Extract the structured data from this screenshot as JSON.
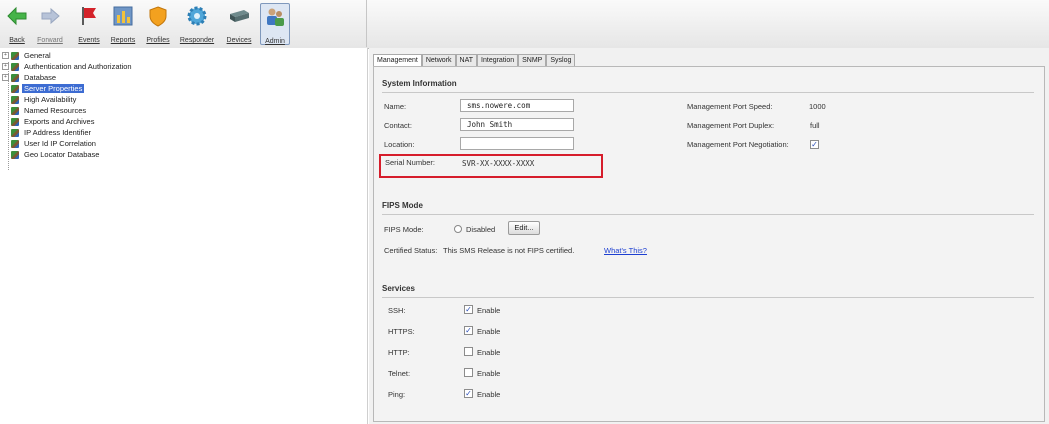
{
  "toolbar": {
    "buttons": [
      {
        "label": "Back",
        "icon": "back-arrow-icon"
      },
      {
        "label": "Forward",
        "icon": "forward-arrow-icon"
      },
      {
        "label": "Events",
        "icon": "flag-icon"
      },
      {
        "label": "Reports",
        "icon": "reports-icon"
      },
      {
        "label": "Profiles",
        "icon": "shield-icon"
      },
      {
        "label": "Responder",
        "icon": "gear-icon"
      },
      {
        "label": "Devices",
        "icon": "device-icon"
      },
      {
        "label": "Admin",
        "icon": "admin-users-icon"
      }
    ]
  },
  "tree": {
    "items": [
      {
        "label": "General",
        "expandable": true
      },
      {
        "label": "Authentication and Authorization",
        "expandable": true
      },
      {
        "label": "Database",
        "expandable": true
      },
      {
        "label": "Server Properties",
        "selected": true
      },
      {
        "label": "High Availability"
      },
      {
        "label": "Named Resources"
      },
      {
        "label": "Exports and Archives"
      },
      {
        "label": "IP Address Identifier"
      },
      {
        "label": "User Id IP Correlation"
      },
      {
        "label": "Geo Locator Database"
      }
    ]
  },
  "tabs": [
    "Management",
    "Network",
    "NAT",
    "Integration",
    "SNMP",
    "Syslog"
  ],
  "active_tab": "Management",
  "system_info": {
    "title": "System Information",
    "name_label": "Name:",
    "name_value": "sms.nowere.com",
    "contact_label": "Contact:",
    "contact_value": "John Smith",
    "location_label": "Location:",
    "location_value": "",
    "serial_label": "Serial Number:",
    "serial_value": "SVR-XX-XXXX-XXXX",
    "port_speed_label": "Management Port Speed:",
    "port_speed_value": "1000",
    "port_duplex_label": "Management Port Duplex:",
    "port_duplex_value": "full",
    "port_negotiation_label": "Management Port Negotiation:",
    "port_negotiation_checked": true
  },
  "fips": {
    "title": "FIPS Mode",
    "mode_label": "FIPS Mode:",
    "mode_value": "Disabled",
    "edit_label": "Edit...",
    "status_label": "Certified Status:",
    "status_text": "This SMS Release is not FIPS certified.",
    "whats_this": "What's This?"
  },
  "services": {
    "title": "Services",
    "items": [
      {
        "label": "SSH:",
        "enable_label": "Enable",
        "checked": true
      },
      {
        "label": "HTTPS:",
        "enable_label": "Enable",
        "checked": true
      },
      {
        "label": "HTTP:",
        "enable_label": "Enable",
        "checked": false
      },
      {
        "label": "Telnet:",
        "enable_label": "Enable",
        "checked": false
      },
      {
        "label": "Ping:",
        "enable_label": "Enable",
        "checked": true
      }
    ]
  },
  "colors": {
    "highlight_box": "#d61d2b",
    "selected_row": "#3d6cd2",
    "link": "#1d3fd1"
  }
}
